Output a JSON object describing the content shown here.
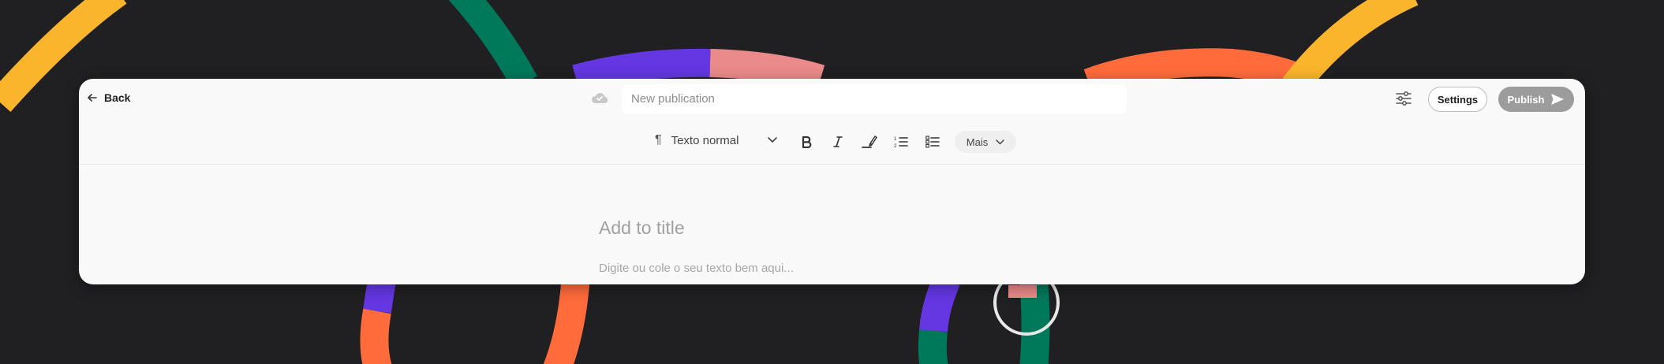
{
  "header": {
    "back_label": "Back",
    "publication_placeholder": "New publication",
    "settings_label": "Settings",
    "publish_label": "Publish"
  },
  "toolbar": {
    "paragraph_style": "Texto normal",
    "more_label": "Mais",
    "tools": [
      "bold-icon",
      "italic-icon",
      "highlighter-icon",
      "numbered-list-icon",
      "checklist-icon"
    ]
  },
  "editor": {
    "title_placeholder": "Add to title",
    "body_placeholder": "Digite ou cole o seu texto bem aqui..."
  },
  "colors": {
    "background": "#201f21",
    "window": "#f9f9f9",
    "publish_disabled": "#9c9c9c",
    "decor_yellow": "#fbb52c",
    "decor_green": "#00785a",
    "decor_purple": "#6437e2",
    "decor_orange": "#ff6b3b",
    "decor_pink": "#ea8a8a"
  }
}
